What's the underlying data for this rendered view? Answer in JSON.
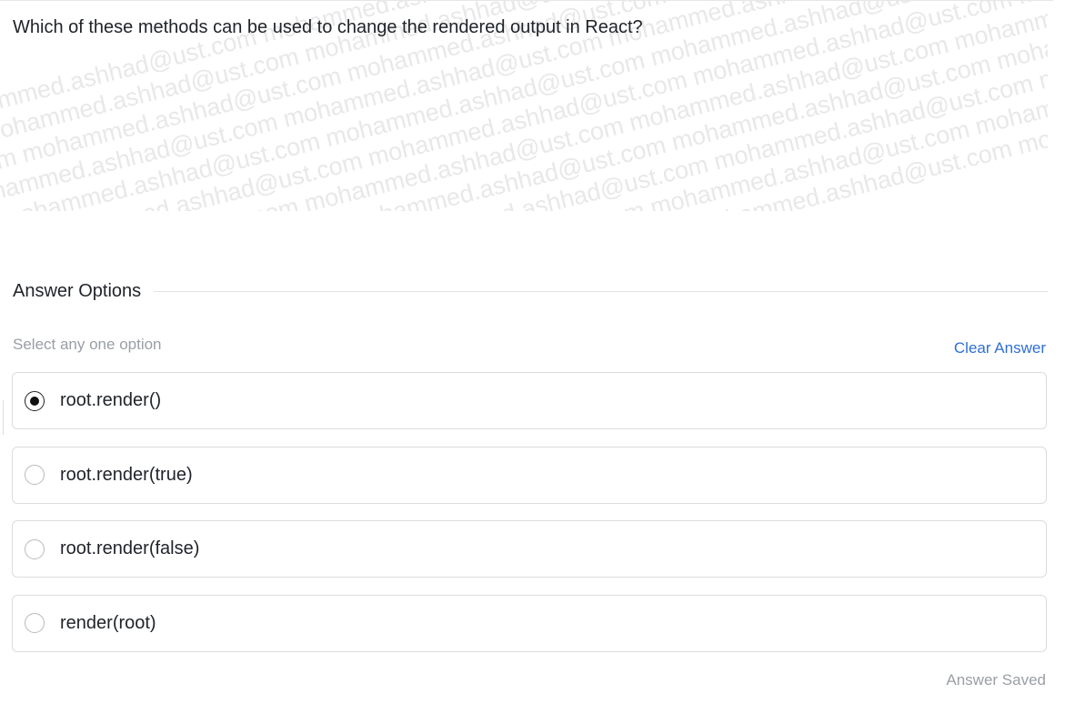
{
  "question": {
    "text": "Which of these methods can be used to change the rendered output in React?",
    "watermark_text": "mohammed.ashhad@ust.com"
  },
  "answer_section": {
    "title": "Answer Options",
    "hint": "Select any one option",
    "clear_label": "Clear Answer"
  },
  "options": [
    {
      "label": "root.render()",
      "selected": true
    },
    {
      "label": "root.render(true)",
      "selected": false
    },
    {
      "label": "root.render(false)",
      "selected": false
    },
    {
      "label": "render(root)",
      "selected": false
    }
  ],
  "status": {
    "text": "Answer Saved"
  },
  "colors": {
    "accent": "#2f6fd6",
    "muted_text": "#9a9ea5",
    "border": "#dcdcdc",
    "watermark": "#e8e8e8"
  }
}
